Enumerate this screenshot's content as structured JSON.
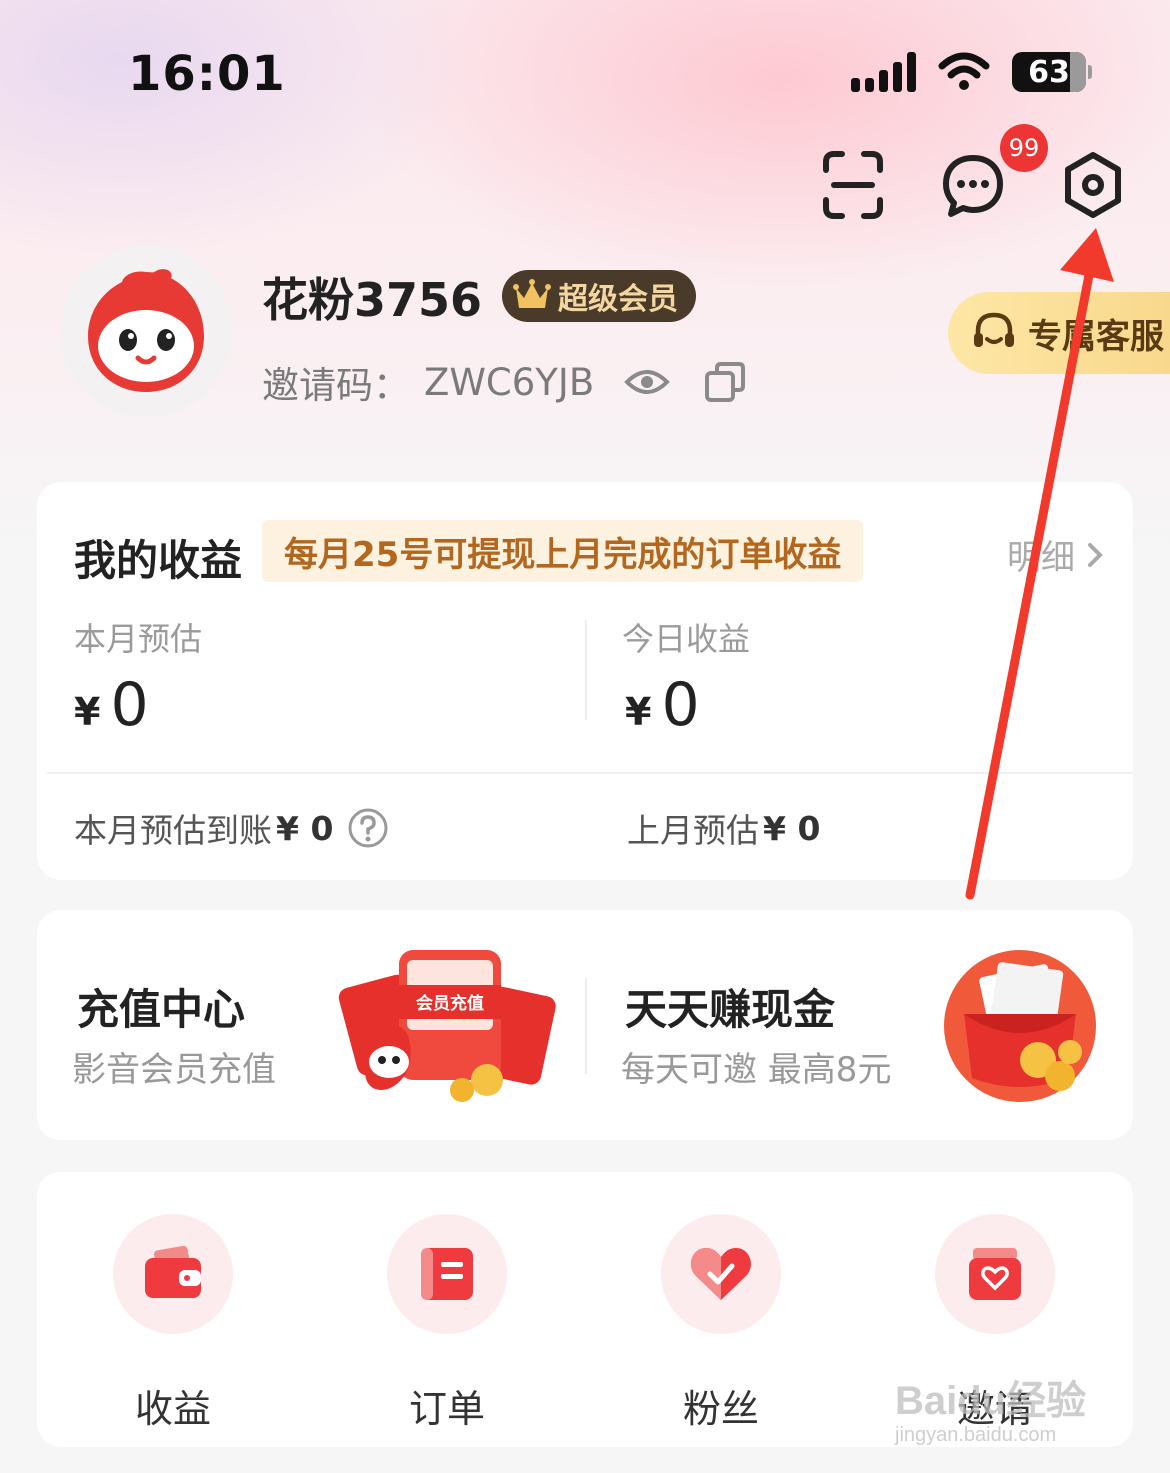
{
  "status_bar": {
    "time": "16:01",
    "battery": "63"
  },
  "header": {
    "messages_badge": "99"
  },
  "profile": {
    "username": "花粉3756",
    "vip_label": "超级会员",
    "invite_label": "邀请码：",
    "invite_code": "ZWC6YJB",
    "service_label": "专属客服"
  },
  "earnings": {
    "title": "我的收益",
    "tip": "每月25号可提现上月完成的订单收益",
    "detail_label": "明细",
    "currency": "¥",
    "month_estimate_label": "本月预估",
    "month_estimate_value": "0",
    "today_label": "今日收益",
    "today_value": "0",
    "arrival_label": "本月预估到账",
    "arrival_value": "¥ 0",
    "last_month_label": "上月预估",
    "last_month_value": "¥ 0"
  },
  "promo": {
    "recharge_title": "充值中心",
    "recharge_sub": "影音会员充值",
    "recharge_image_text": "会员充值",
    "cash_title": "天天赚现金",
    "cash_sub": "每天可邀 最高8元"
  },
  "menu": {
    "items": [
      {
        "label": "收益"
      },
      {
        "label": "订单"
      },
      {
        "label": "粉丝"
      },
      {
        "label": "邀请"
      }
    ]
  },
  "watermark": {
    "brand": "Baidu经验",
    "url": "jingyan.baidu.com"
  },
  "colors": {
    "accent_red": "#ee3535",
    "vip_dark": "#4a3a2a",
    "tip_bg": "#fdf1df",
    "service_gold": "#f8d78a"
  }
}
